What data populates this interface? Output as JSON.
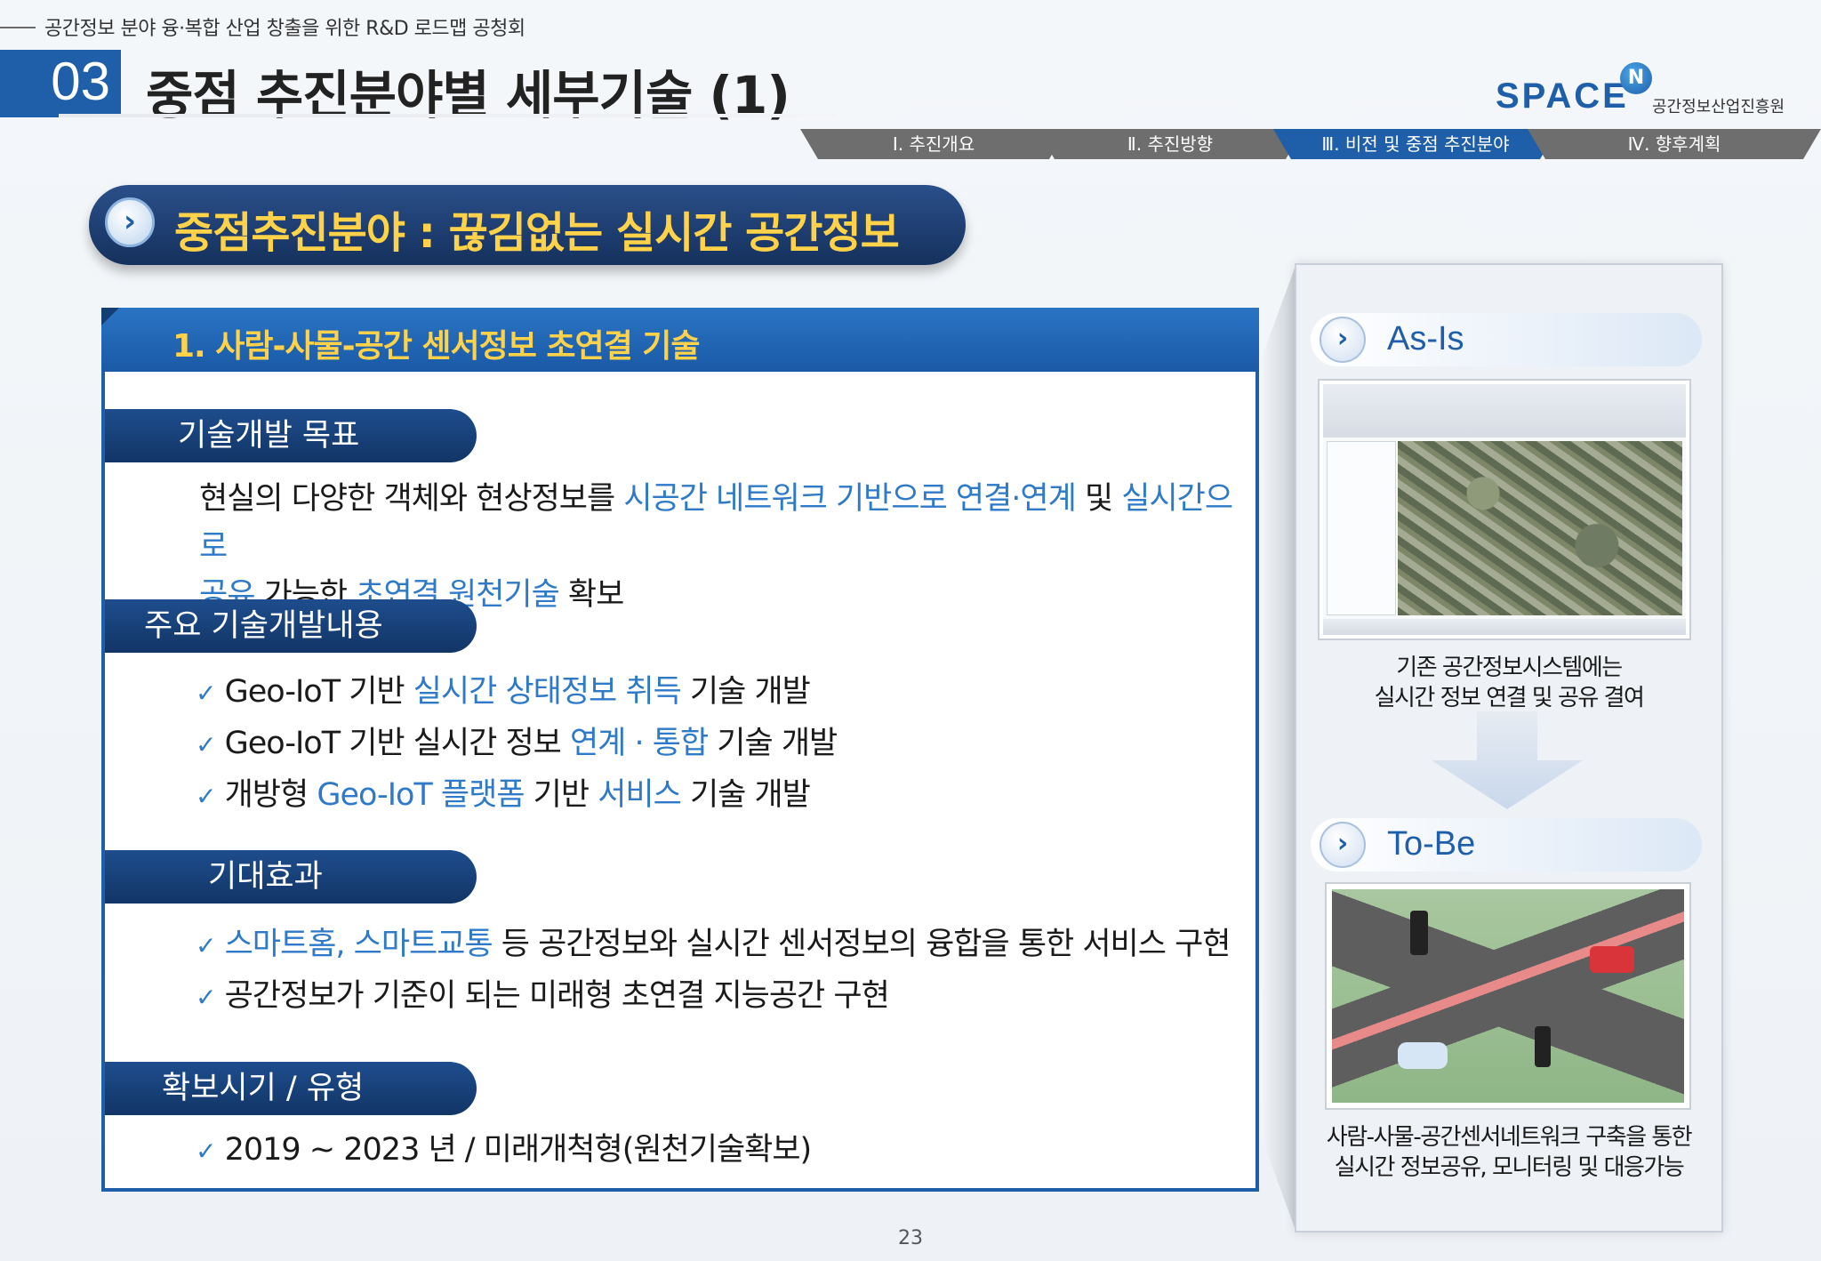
{
  "header": {
    "conference_title": "공간정보 분야 융·복합 산업 창출을 위한 R&D 로드맵 공청회",
    "section_number": "03",
    "page_title": "중점 추진분야별 세부기술 (1)"
  },
  "logo": {
    "text": "SPACE",
    "badge": "N",
    "org_name": "공간정보산업진흥원"
  },
  "nav": {
    "tabs": [
      {
        "label": "Ⅰ. 추진개요"
      },
      {
        "label": "Ⅱ. 추진방향"
      },
      {
        "label": "Ⅲ. 비전 및 중점 추진분야"
      },
      {
        "label": "Ⅳ. 향후계획"
      }
    ],
    "active_index": 2
  },
  "banner": {
    "text": "중점추진분야 : 끊김없는 실시간 공간정보"
  },
  "main": {
    "heading": "1. 사람-사물-공간 센서정보 초연결 기술",
    "goal": {
      "label": "기술개발 목표",
      "line1_a": "현실의 다양한 객체와 현상정보를 ",
      "line1_b": "시공간 네트워크 기반으로 연결·연계",
      "line1_c": " 및 ",
      "line1_d": "실시간으로",
      "line2_a": "공유",
      "line2_b": " 가능한 ",
      "line2_c": "초연결 원천기술",
      "line2_d": " 확보"
    },
    "content": {
      "label": "주요 기술개발내용",
      "items": [
        {
          "a": "Geo-IoT 기반 ",
          "b": "실시간 상태정보 취득",
          "c": " 기술 개발"
        },
        {
          "a": "Geo-IoT 기반 실시간 정보 ",
          "b": "연계 · 통합",
          "c": " 기술 개발"
        },
        {
          "a": "개방형 ",
          "b": "Geo-IoT 플랫폼",
          "c": " 기반 ",
          "d": "서비스",
          "e": " 기술 개발"
        }
      ]
    },
    "effect": {
      "label": "기대효과",
      "items": [
        {
          "a": "스마트홈, 스마트교통",
          "b": " 등 공간정보와 실시간 센서정보의 융합을 통한 서비스 구현"
        },
        {
          "a": "공간정보가 기준이 되는 미래형 초연결 지능공간 구현"
        }
      ]
    },
    "period": {
      "label": "확보시기 / 유형",
      "text": "2019 ~ 2023 년 / 미래개척형(원천기술확보)"
    }
  },
  "side": {
    "asis_label": "As-Is",
    "asis_caption_1": "기존 공간정보시스템에는",
    "asis_caption_2": "실시간 정보 연결 및 공유 결여",
    "tobe_label": "To-Be",
    "tobe_caption_1": "사람-사물-공간센서네트워크 구축을 통한",
    "tobe_caption_2": "실시간 정보공유, 모니터링 및 대응가능"
  },
  "page_number": "23",
  "colors": {
    "primary_blue": "#1f5ea8",
    "highlight_blue": "#2e7ac8",
    "accent_yellow": "#ffd24a",
    "nav_gray": "#6e6e6e"
  },
  "icons": {
    "check": "checkmark-icon",
    "chevron": "chevron-right-icon"
  }
}
